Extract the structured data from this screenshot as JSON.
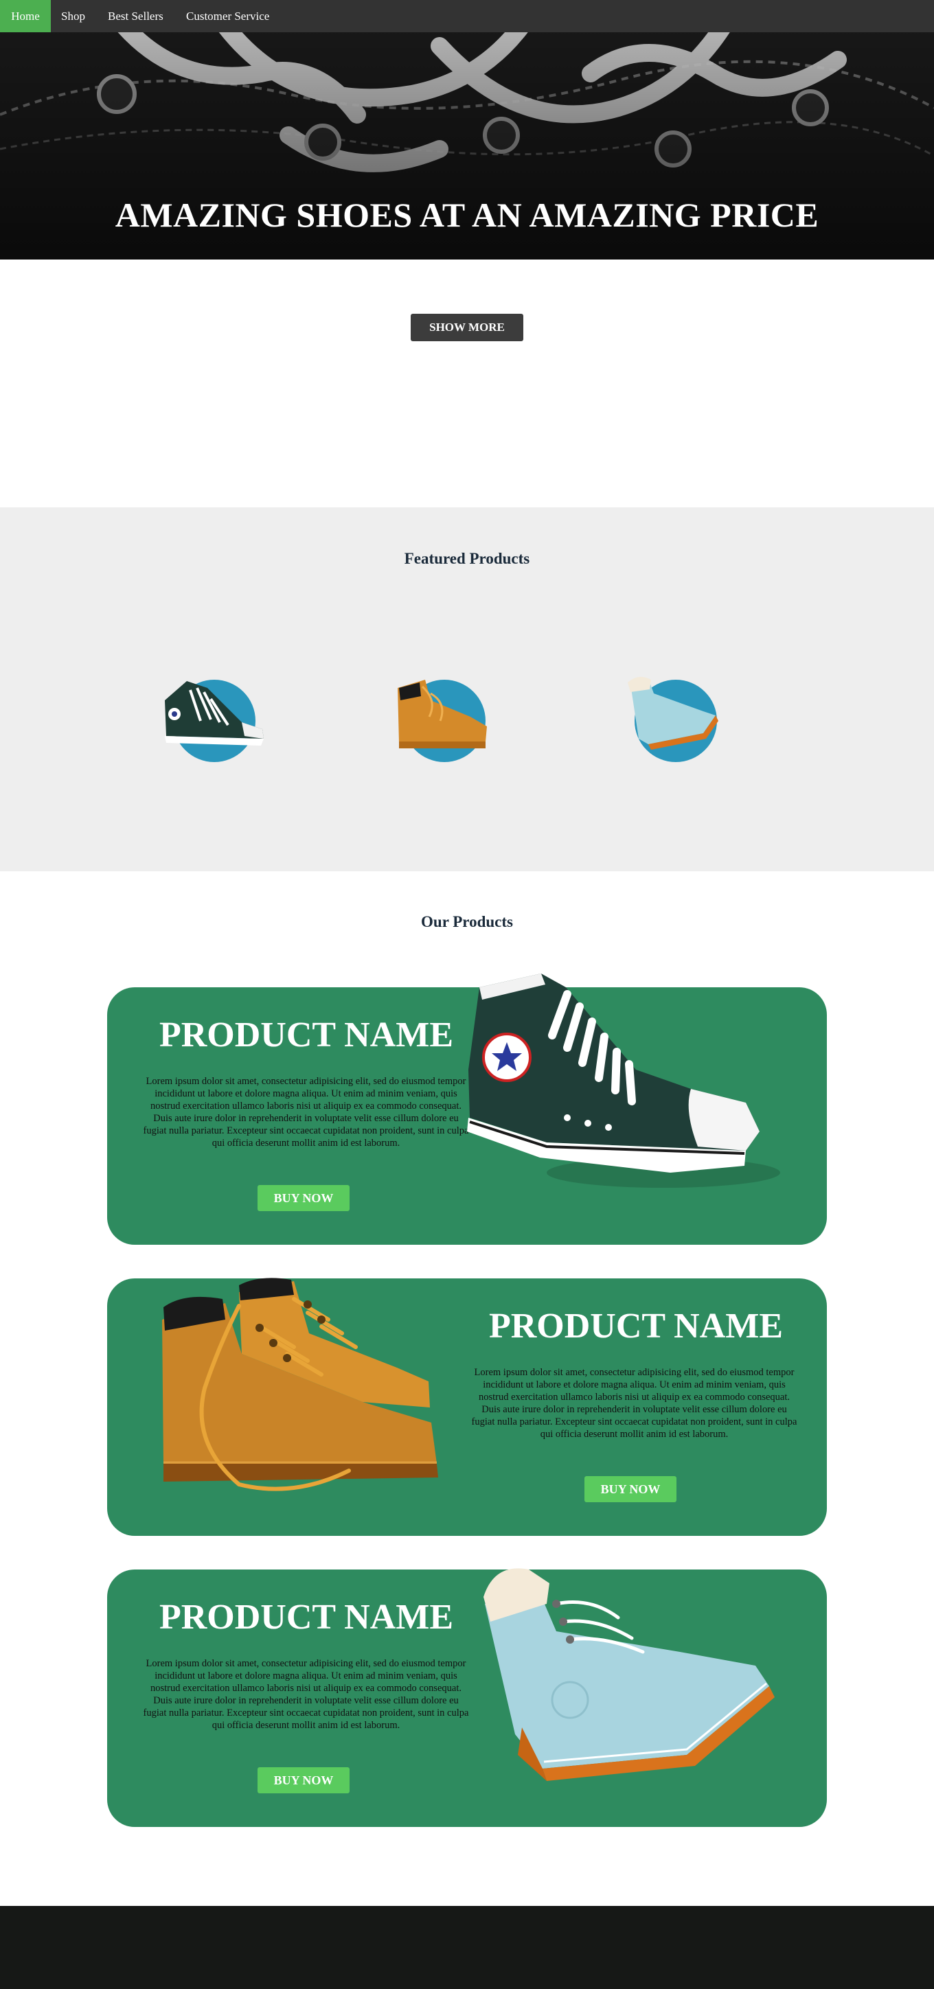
{
  "nav": {
    "items": [
      {
        "label": "Home",
        "active": true
      },
      {
        "label": "Shop",
        "active": false
      },
      {
        "label": "Best Sellers",
        "active": false
      },
      {
        "label": "Customer Service",
        "active": false
      }
    ]
  },
  "hero": {
    "title": "AMAZING SHOES AT AN AMAZING PRICE",
    "image_icon": "sneaker-laces-photo"
  },
  "cta": {
    "show_more_label": "SHOW MORE"
  },
  "featured": {
    "title": "Featured Products",
    "items": [
      {
        "icon": "green-sneaker-icon"
      },
      {
        "icon": "tan-boot-icon"
      },
      {
        "icon": "blue-boot-icon"
      }
    ]
  },
  "products": {
    "title": "Our Products",
    "items": [
      {
        "name": "PRODUCT NAME",
        "description": "Lorem ipsum dolor sit amet, consectetur adipisicing elit, sed do eiusmod tempor incididunt ut labore et dolore magna aliqua. Ut enim ad minim veniam, quis nostrud exercitation ullamco laboris nisi ut aliquip ex ea commodo consequat. Duis aute irure dolor in reprehenderit in voluptate velit esse cillum dolore eu fugiat nulla pariatur. Excepteur sint occaecat cupidatat non proident, sunt in culpa qui officia deserunt mollit anim id est laborum.",
        "button": "BUY NOW",
        "image_icon": "green-high-top-sneaker"
      },
      {
        "name": "PRODUCT NAME",
        "description": "Lorem ipsum dolor sit amet, consectetur adipisicing elit, sed do eiusmod tempor incididunt ut labore et dolore magna aliqua. Ut enim ad minim veniam, quis nostrud exercitation ullamco laboris nisi ut aliquip ex ea commodo consequat. Duis aute irure dolor in reprehenderit in voluptate velit esse cillum dolore eu fugiat nulla pariatur. Excepteur sint occaecat cupidatat non proident, sunt in culpa qui officia deserunt mollit anim id est laborum.",
        "button": "BUY NOW",
        "image_icon": "tan-work-boots"
      },
      {
        "name": "PRODUCT NAME",
        "description": "Lorem ipsum dolor sit amet, consectetur adipisicing elit, sed do eiusmod tempor incididunt ut labore et dolore magna aliqua. Ut enim ad minim veniam, quis nostrud exercitation ullamco laboris nisi ut aliquip ex ea commodo consequat. Duis aute irure dolor in reprehenderit in voluptate velit esse cillum dolore eu fugiat nulla pariatur. Excepteur sint occaecat cupidatat non proident, sunt in culpa qui officia deserunt mollit anim id est laborum.",
        "button": "BUY NOW",
        "image_icon": "light-blue-boot"
      }
    ]
  },
  "colors": {
    "nav_bg": "#333333",
    "nav_active": "#4caf50",
    "card_green": "#2e8b5f",
    "button_green": "#5acb5e",
    "featured_bg": "#eeeeee",
    "circle_blue": "#2a96bc",
    "footer_bg": "#161816"
  }
}
